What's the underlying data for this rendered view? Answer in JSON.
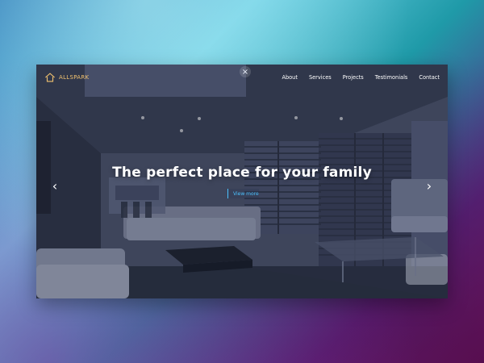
{
  "site": {
    "logo_text": "ALLSPARK",
    "nav": [
      {
        "label": "About"
      },
      {
        "label": "Services"
      },
      {
        "label": "Projects"
      },
      {
        "label": "Testimonials"
      },
      {
        "label": "Contact"
      }
    ],
    "close_label": "×"
  },
  "hero": {
    "title": "The perfect place for your family",
    "cta_label": "View more",
    "arrow_left": "‹",
    "arrow_right": "›"
  },
  "colors": {
    "accent": "#4cc2ff",
    "logo": "#f0c16f",
    "hero_overlay": "#3a4158"
  }
}
